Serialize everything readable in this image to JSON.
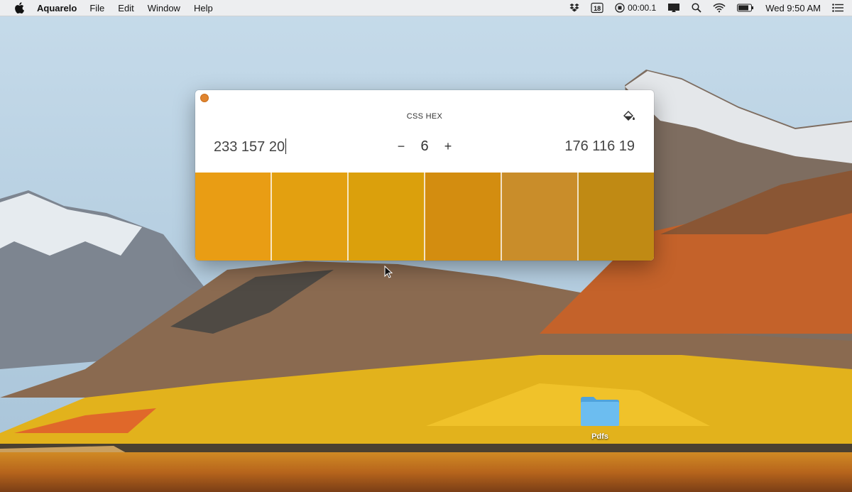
{
  "menubar": {
    "app_name": "Aquarelo",
    "menus": [
      "File",
      "Edit",
      "Window",
      "Help"
    ],
    "calendar_badge": "18",
    "recording_time": "00:00.1",
    "clock": "Wed 9:50 AM"
  },
  "window": {
    "format_label": "CSS HEX",
    "start_color": "233 157 20",
    "end_color": "176 116 19",
    "steps": "6",
    "minus_label": "−",
    "plus_label": "+",
    "swatches": [
      "#e99d14",
      "#e3a010",
      "#dba00c",
      "#d38d10",
      "#c98d2a",
      "#c08a14"
    ]
  },
  "desktop": {
    "folder_label": "Pdfs"
  },
  "colors": {
    "close_dot": "#e0852f",
    "folder": "#5fb4ec"
  }
}
